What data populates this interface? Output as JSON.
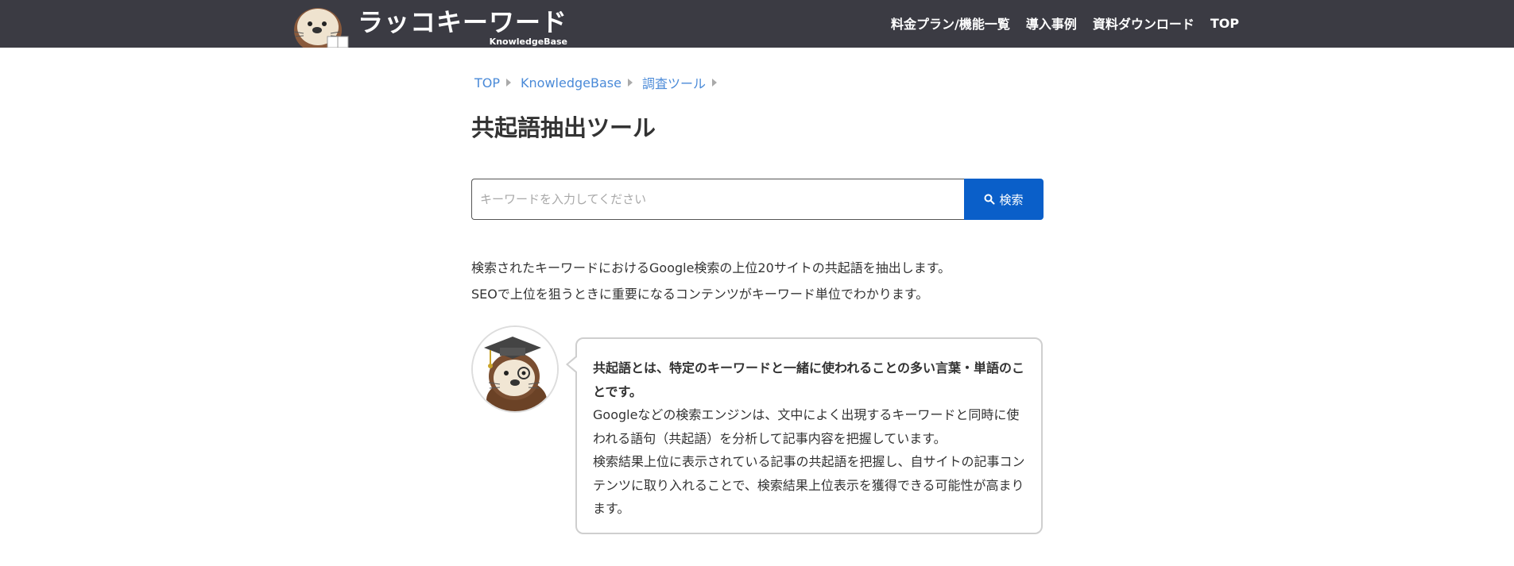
{
  "header": {
    "logo_title": "ラッコキーワード",
    "logo_sub": "KnowledgeBase",
    "nav": [
      {
        "label": "料金プラン/機能一覧"
      },
      {
        "label": "導入事例"
      },
      {
        "label": "資料ダウンロード"
      },
      {
        "label": "TOP"
      }
    ]
  },
  "breadcrumb": [
    {
      "label": "TOP"
    },
    {
      "label": "KnowledgeBase"
    },
    {
      "label": "調査ツール"
    }
  ],
  "page_title": "共起語抽出ツール",
  "search": {
    "placeholder": "キーワードを入力してください",
    "value": "",
    "button_label": "検索"
  },
  "description": {
    "line1": "検索されたキーワードにおけるGoogle検索の上位20サイトの共起語を抽出します。",
    "line2": "SEOで上位を狙うときに重要になるコンテンツがキーワード単位でわかります。"
  },
  "bubble": {
    "lead": "共起語とは、特定のキーワードと一緒に使われることの多い言葉・単語のことです。",
    "p1": "Googleなどの検索エンジンは、文中によく出現するキーワードと同時に使われる語句（共起語）を分析して記事内容を把握しています。",
    "p2": "検索結果上位に表示されている記事の共起語を把握し、自サイトの記事コンテンツに取り入れることで、検索結果上位表示を獲得できる可能性が高まります。"
  },
  "colors": {
    "header_bg": "#3b3b43",
    "link": "#4a8ad8",
    "search_button": "#0a5fc9"
  }
}
